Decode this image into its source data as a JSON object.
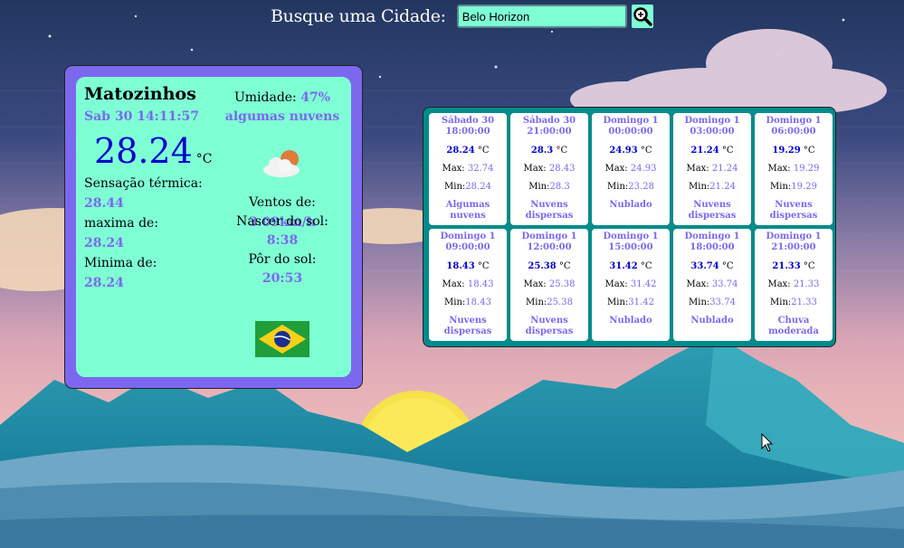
{
  "search": {
    "label": "Busque uma Cidade:",
    "value": "Belo Horizon",
    "button_icon": "search-icon"
  },
  "current": {
    "city": "Matozinhos",
    "datetime": "Sab 30 14:11:57",
    "temperature": "28.24",
    "unit": "°C",
    "feels_like_label": "Sensação térmica:",
    "feels_like": "28.44",
    "max_label": "maxima de:",
    "max": "28.24",
    "min_label": "Minima de:",
    "min": "28.24",
    "humidity_label": "Umidade:",
    "humidity": "47%",
    "description": "algumas nuvens",
    "weather_icon": "partly-cloudy-icon",
    "wind_label": "Ventos de:",
    "wind": "3.09km/h",
    "sunrise_label": "Nascer do sol:",
    "sunrise": "8:38",
    "sunset_label": "Pôr do sol:",
    "sunset": "20:53",
    "flag_icon": "brazil-flag-icon"
  },
  "forecast_labels": {
    "unit": "°C",
    "max_label": "Max:",
    "min_label": "Min:"
  },
  "forecast": [
    {
      "day": "Sábado 30",
      "time": "18:00:00",
      "temp": "28.24",
      "max": "32.74",
      "min": "28.24",
      "desc": "Algumas nuvens"
    },
    {
      "day": "Sábado 30",
      "time": "21:00:00",
      "temp": "28.3",
      "max": "28.43",
      "min": "28.3",
      "desc": "Nuvens dispersas"
    },
    {
      "day": "Domingo 1",
      "time": "00:00:00",
      "temp": "24.93",
      "max": "24.93",
      "min": "23.28",
      "desc": "Nublado"
    },
    {
      "day": "Domingo 1",
      "time": "03:00:00",
      "temp": "21.24",
      "max": "21.24",
      "min": "21.24",
      "desc": "Nuvens dispersas"
    },
    {
      "day": "Domingo 1",
      "time": "06:00:00",
      "temp": "19.29",
      "max": "19.29",
      "min": "19.29",
      "desc": "Nuvens dispersas"
    },
    {
      "day": "Domingo 1",
      "time": "09:00:00",
      "temp": "18.43",
      "max": "18.43",
      "min": "18.43",
      "desc": "Nuvens dispersas"
    },
    {
      "day": "Domingo 1",
      "time": "12:00:00",
      "temp": "25.38",
      "max": "25.38",
      "min": "25.38",
      "desc": "Nuvens dispersas"
    },
    {
      "day": "Domingo 1",
      "time": "15:00:00",
      "temp": "31.42",
      "max": "31.42",
      "min": "31.42",
      "desc": "Nublado"
    },
    {
      "day": "Domingo 1",
      "time": "18:00:00",
      "temp": "33.74",
      "max": "33.74",
      "min": "33.74",
      "desc": "Nublado"
    },
    {
      "day": "Domingo 1",
      "time": "21:00:00",
      "temp": "21.33",
      "max": "21.33",
      "min": "21.33",
      "desc": "Chuva moderada"
    }
  ],
  "colors": {
    "accent": "#7b68ee",
    "panel": "#7fffd4",
    "forecast_bg": "#008b8b",
    "temp_blue": "#0000cd"
  }
}
